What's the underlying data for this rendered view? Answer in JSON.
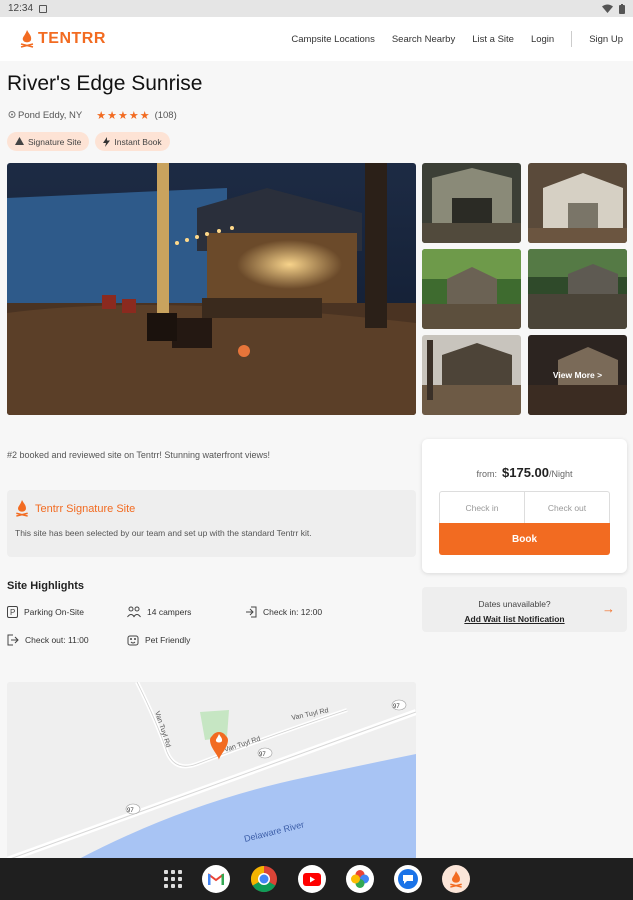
{
  "status": {
    "time": "12:34"
  },
  "brand": {
    "name": "TENTRR",
    "accent": "#f26b21"
  },
  "nav": {
    "links": [
      "Campsite Locations",
      "Search Nearby",
      "List a Site",
      "Login",
      "Sign Up"
    ]
  },
  "listing": {
    "title": "River's Edge Sunrise",
    "location": "Pond Eddy, NY",
    "rating_stars": 5,
    "review_count": "(108)",
    "badges": [
      "Signature Site",
      "Instant Book"
    ],
    "view_more": "View More >",
    "description": "#2 booked and reviewed site on Tentrr! Stunning waterfront views!"
  },
  "signature": {
    "title": "Tentrr Signature Site",
    "text": "This site has been selected by our team and set up with the standard Tentrr kit."
  },
  "highlights": {
    "title": "Site Highlights",
    "items": [
      {
        "icon": "parking-icon",
        "label": "Parking On-Site"
      },
      {
        "icon": "people-icon",
        "label": "14 campers"
      },
      {
        "icon": "check-in-icon",
        "label": "Check in: 12:00"
      },
      {
        "icon": "check-out-icon",
        "label": "Check out: 11:00"
      },
      {
        "icon": "pet-icon",
        "label": "Pet Friendly"
      }
    ]
  },
  "map": {
    "roads": [
      "Van Tuyl Rd",
      "Van Tuyl Rd",
      "Van Tuyl Rd"
    ],
    "route_shields": [
      "97",
      "97",
      "97"
    ],
    "river": "Delaware River"
  },
  "booking": {
    "from_label": "from",
    "price": "$175.00",
    "per": "/Night",
    "check_in": "Check in",
    "check_out": "Check out",
    "book": "Book"
  },
  "waitlist": {
    "question": "Dates unavailable?",
    "link": "Add Wait list Notification"
  },
  "taskbar": {
    "apps": [
      "apps-grid-icon",
      "gmail-icon",
      "chrome-icon",
      "youtube-icon",
      "photos-icon",
      "messages-icon",
      "tentrr-app-icon"
    ]
  }
}
